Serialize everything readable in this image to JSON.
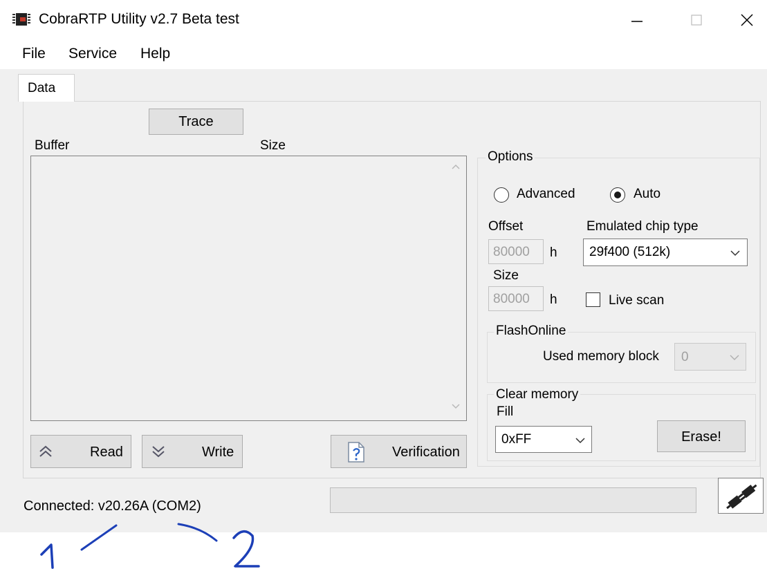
{
  "window": {
    "title": "CobraRTP Utility v2.7 Beta test",
    "controls": {
      "minimize": "—",
      "maximize": "☐",
      "close": "✕"
    }
  },
  "menu": {
    "items": [
      {
        "label": "File"
      },
      {
        "label": "Service"
      },
      {
        "label": "Help"
      }
    ]
  },
  "tabs": [
    {
      "label": "Data",
      "active": true
    }
  ],
  "data_panel": {
    "trace_label": "Trace",
    "buffer_header": "Buffer",
    "size_header": "Size",
    "buffer_rows": [],
    "read_label": "Read",
    "write_label": "Write",
    "verification_label": "Verification"
  },
  "options": {
    "group_title": "Options",
    "radio_advanced_label": "Advanced",
    "radio_auto_label": "Auto",
    "selected_mode": "Auto",
    "offset_label": "Offset",
    "offset_value": "80000",
    "offset_suffix": "h",
    "size_label": "Size",
    "size_value": "80000",
    "size_suffix": "h",
    "chip_type_label": "Emulated chip type",
    "chip_type_value": "29f400 (512k)",
    "live_scan_label": "Live scan",
    "live_scan_checked": false
  },
  "flash_online": {
    "group_title": "FlashOnline",
    "used_block_label": "Used memory block",
    "used_block_value": "0"
  },
  "clear_memory": {
    "group_title": "Clear memory",
    "fill_label": "Fill",
    "fill_value": "0xFF",
    "erase_label": "Erase!"
  },
  "status": {
    "connection_text": "Connected: v20.26A (COM2)",
    "progress_percent": 0
  },
  "annotations": {
    "mark_1": "1",
    "mark_2": "2"
  },
  "icons": {
    "app": "chip-icon",
    "read": "double-chevron-up-icon",
    "write": "double-chevron-down-icon",
    "verification": "document-question-icon",
    "connect": "plug-connector-icon"
  }
}
